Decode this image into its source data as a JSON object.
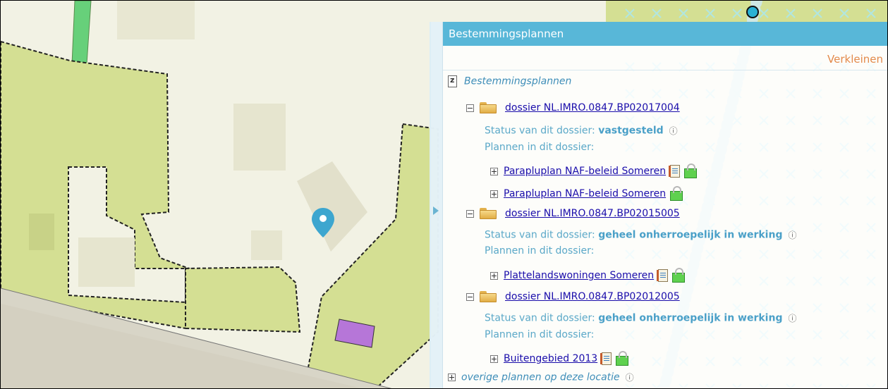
{
  "panel": {
    "title": "Bestemmingsplannen",
    "collapse_label": "Verkleinen",
    "root_label": "Bestemmingsplannen",
    "dossiers": [
      {
        "name": "dossier NL.IMRO.0847.BP02017004",
        "status_prefix": "Status van dit dossier:",
        "status": "vastgesteld",
        "plans_label": "Plannen in dit dossier:",
        "plans": [
          "Parapluplan NAF-beleid Someren",
          "Parapluplan NAF-beleid Someren"
        ]
      },
      {
        "name": "dossier NL.IMRO.0847.BP02015005",
        "status_prefix": "Status van dit dossier:",
        "status": "geheel onherroepelijk in werking",
        "plans_label": "Plannen in dit dossier:",
        "plans": [
          "Plattelandswoningen Someren"
        ]
      },
      {
        "name": "dossier NL.IMRO.0847.BP02012005",
        "status_prefix": "Status van dit dossier:",
        "status": "geheel onherroepelijk in werking",
        "plans_label": "Plannen in dit dossier:",
        "plans": [
          "Buitengebied 2013"
        ]
      }
    ],
    "other_plans_label": "overige plannen op deze locatie"
  },
  "colors": {
    "header": "#58b7d8",
    "collapse_link": "#e38a4b",
    "parcel_green": "#d4df93",
    "map_bg": "#f2f2e4",
    "road": "#d8d5c7",
    "marker": "#3da6cf",
    "building_purple": "#b676d8"
  }
}
